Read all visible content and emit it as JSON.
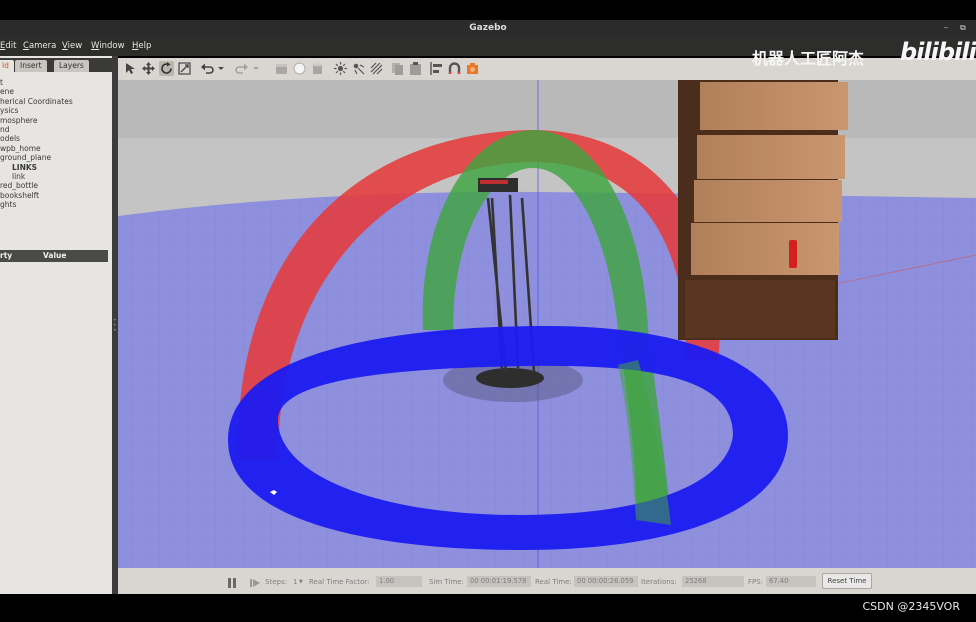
{
  "window": {
    "title": "Gazebo"
  },
  "menu": [
    {
      "label": "Edit",
      "u": "E",
      "rest": "dit"
    },
    {
      "label": "Camera",
      "u": "C",
      "rest": "amera"
    },
    {
      "label": "View",
      "u": "V",
      "rest": "iew"
    },
    {
      "label": "Window",
      "u": "W",
      "rest": "indow"
    },
    {
      "label": "Help",
      "u": "H",
      "rest": "elp"
    }
  ],
  "left_panel": {
    "tabs": [
      "ld",
      "Insert",
      "Layers"
    ],
    "tree": [
      "t",
      "ene",
      "herical Coordinates",
      "ysics",
      "mosphere",
      "nd",
      "odels",
      "wpb_home",
      "ground_plane",
      "LINKS",
      "link",
      "red_bottle",
      "bookshelft",
      "ghts"
    ],
    "property_header": {
      "property": "rty",
      "value": "Value"
    }
  },
  "toolbar": {
    "icons": [
      "select-arrow-icon",
      "translate-icon",
      "rotate-icon",
      "scale-icon",
      "undo-icon",
      "undo-dropdown-icon",
      "redo-icon",
      "redo-dropdown-icon",
      "box-icon",
      "sphere-icon",
      "cylinder-icon",
      "point-light-icon",
      "spot-light-icon",
      "directional-light-icon",
      "copy-icon",
      "paste-icon",
      "align-icon",
      "snap-icon",
      "screenshot-icon"
    ]
  },
  "status": {
    "steps_label": "Steps:",
    "steps_value": "1",
    "rtf_label": "Real Time Factor:",
    "rtf_value": "1.00",
    "sim_time_label": "Sim Time:",
    "sim_time_value": "00 00:01:19.578",
    "real_time_label": "Real Time:",
    "real_time_value": "00 00:00:26.059",
    "iterations_label": "Iterations:",
    "iterations_value": "25268",
    "fps_label": "FPS:",
    "fps_value": "67.40",
    "reset_label": "Reset Time"
  },
  "overlay": {
    "watermark": "机器人工匠阿杰",
    "logo": "bilibili",
    "credit": "CSDN @2345VOR"
  },
  "colors": {
    "ring_red": "#e53b3b",
    "ring_green": "#3fa53f",
    "ring_blue": "#1c1cf0",
    "ground": "#8f8fe0",
    "accent": "#d0542a"
  }
}
